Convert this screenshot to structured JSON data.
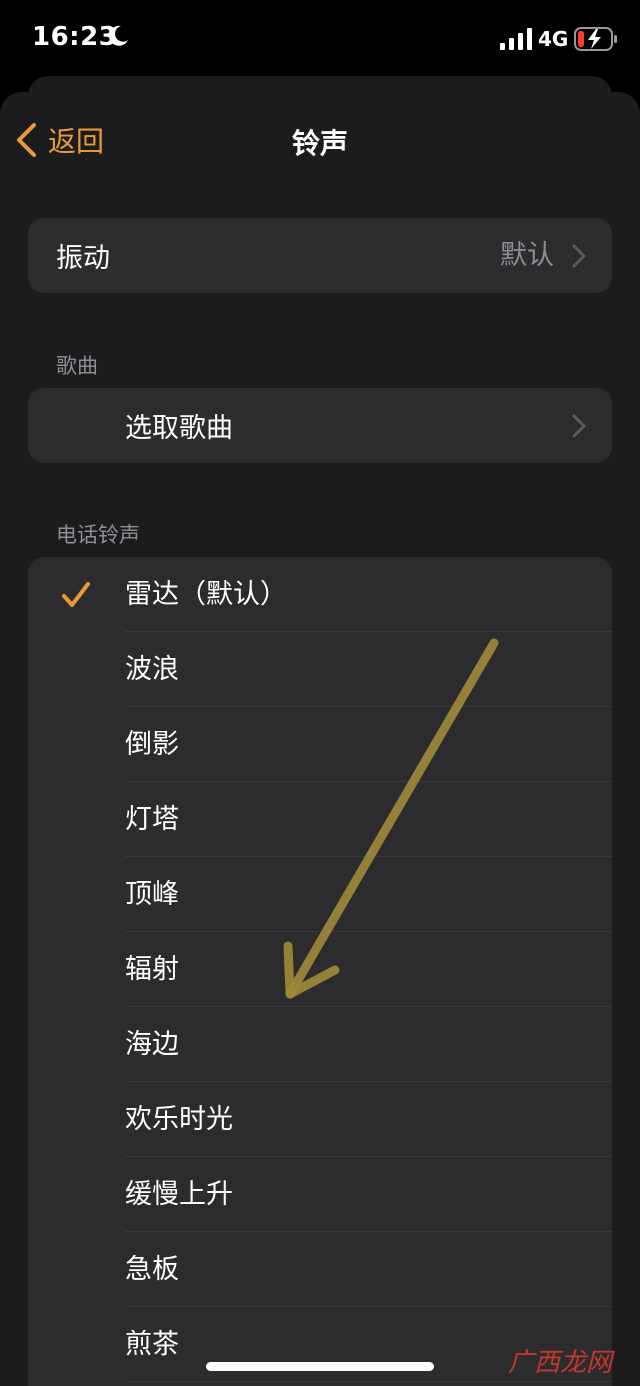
{
  "status_bar": {
    "time": "16:23",
    "network": "4G",
    "icons": [
      "moon-icon",
      "signal-icon",
      "battery-charging-icon"
    ]
  },
  "nav": {
    "back_label": "返回",
    "title": "铃声"
  },
  "vibration": {
    "label": "振动",
    "value": "默认"
  },
  "songs_section": {
    "header": "歌曲",
    "pick_label": "选取歌曲"
  },
  "ringtones_section": {
    "header": "电话铃声",
    "items": [
      {
        "label": "雷达（默认）",
        "selected": true
      },
      {
        "label": "波浪",
        "selected": false
      },
      {
        "label": "倒影",
        "selected": false
      },
      {
        "label": "灯塔",
        "selected": false
      },
      {
        "label": "顶峰",
        "selected": false
      },
      {
        "label": "辐射",
        "selected": false
      },
      {
        "label": "海边",
        "selected": false
      },
      {
        "label": "欢乐时光",
        "selected": false
      },
      {
        "label": "缓慢上升",
        "selected": false
      },
      {
        "label": "急板",
        "selected": false
      },
      {
        "label": "煎茶",
        "selected": false
      }
    ]
  },
  "watermark": "广西龙网",
  "colors": {
    "accent": "#e69a3a",
    "background": "#000000",
    "sheet": "#1c1c1e",
    "cell": "#2c2c2e",
    "secondary_text": "#8e8e93",
    "annotation_arrow": "#a08a3a"
  }
}
